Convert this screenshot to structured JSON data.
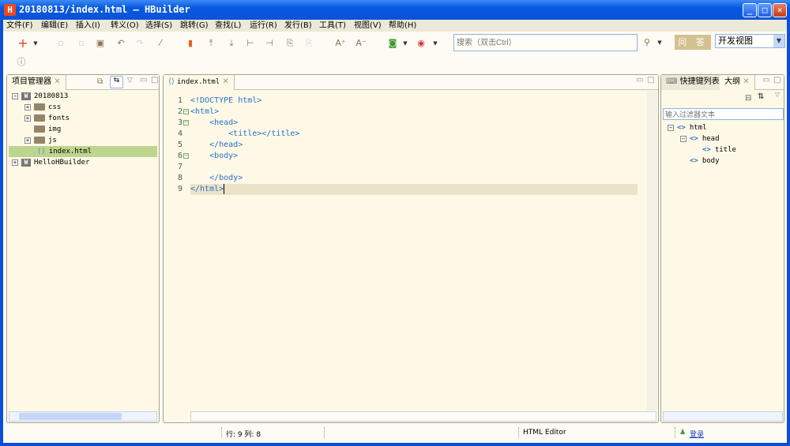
{
  "window": {
    "title": "20180813/index.html — HBuilder",
    "logo": "H",
    "minimize": "_",
    "maximize": "□",
    "close": "✕"
  },
  "menu": [
    "文件(F)",
    "编辑(E)",
    "插入(I)",
    "转义(O)",
    "选择(S)",
    "跳转(G)",
    "查找(L)",
    "运行(R)",
    "发行(B)",
    "工具(T)",
    "视图(V)",
    "帮助(H)"
  ],
  "toolbar": {
    "search_placeholder": "搜索（双击Ctrl）",
    "ask_label": "问 答",
    "view_select": "开发视图"
  },
  "project_panel": {
    "tab": "项目管理器",
    "tree": [
      {
        "label": "20180813",
        "level": 0,
        "type": "project",
        "expanded": true
      },
      {
        "label": "css",
        "level": 1,
        "type": "folder",
        "expandable": true
      },
      {
        "label": "fonts",
        "level": 1,
        "type": "folder",
        "expandable": true
      },
      {
        "label": "img",
        "level": 1,
        "type": "folder",
        "expandable": false
      },
      {
        "label": "js",
        "level": 1,
        "type": "folder",
        "expandable": true
      },
      {
        "label": "index.html",
        "level": 1,
        "type": "file",
        "selected": true
      },
      {
        "label": "HelloHBuilder",
        "level": 0,
        "type": "project",
        "expanded": false
      }
    ]
  },
  "editor": {
    "tab": "index.html",
    "lines": [
      {
        "n": "1",
        "code": "<!DOCTYPE html>"
      },
      {
        "n": "2",
        "code": "<html>",
        "fold": true
      },
      {
        "n": "3",
        "code": "    <head>",
        "fold": true
      },
      {
        "n": "4",
        "code": "        <title></title>"
      },
      {
        "n": "5",
        "code": "    </head>"
      },
      {
        "n": "6",
        "code": "    <body>",
        "fold": true
      },
      {
        "n": "7",
        "code": ""
      },
      {
        "n": "8",
        "code": "    </body>"
      },
      {
        "n": "9",
        "code": "</html>",
        "current": true
      }
    ]
  },
  "right_panel": {
    "tabs": [
      "快捷键列表",
      "大纲"
    ],
    "filter_placeholder": "输入过滤器文本",
    "outline": [
      {
        "label": "html",
        "level": 0,
        "expanded": true
      },
      {
        "label": "head",
        "level": 1,
        "expanded": true
      },
      {
        "label": "title",
        "level": 2
      },
      {
        "label": "body",
        "level": 1
      }
    ]
  },
  "status": {
    "position": "行: 9 列: 8",
    "editor_type": "HTML Editor",
    "login": "登录"
  },
  "colors": {
    "selection": "#bdd58e",
    "current_line": "#ebe3c8",
    "tag": "#2a6fc9",
    "title_bar": "#0a54d8"
  }
}
